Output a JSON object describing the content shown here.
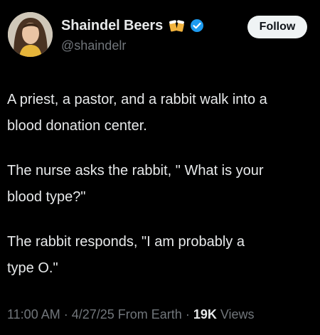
{
  "author": {
    "display_name": "Shaindel Beers",
    "handle": "@shaindelr",
    "name_emoji": "beer-mugs-icon",
    "verified": true
  },
  "follow_button": {
    "label": "Follow"
  },
  "tweet": {
    "paragraphs": [
      {
        "line1": "A priest, a pastor, and a rabbit walk into a",
        "line2": "blood donation center."
      },
      {
        "line1": "The nurse asks the rabbit, \" What is your",
        "line2": "blood type?\""
      },
      {
        "line1": "The rabbit responds, \"I am probably a",
        "line2": "type O.\""
      }
    ]
  },
  "meta": {
    "time": "11:00 AM",
    "sep1": " · ",
    "date": "4/27/25",
    "source": " From Earth",
    "sep2": " · ",
    "views_count": "19K",
    "views_label": " Views"
  },
  "colors": {
    "background": "#000000",
    "text": "#e7e9ea",
    "secondary_text": "#71767b",
    "verified_blue": "#1d9bf0",
    "follow_bg": "#eff3f4"
  }
}
